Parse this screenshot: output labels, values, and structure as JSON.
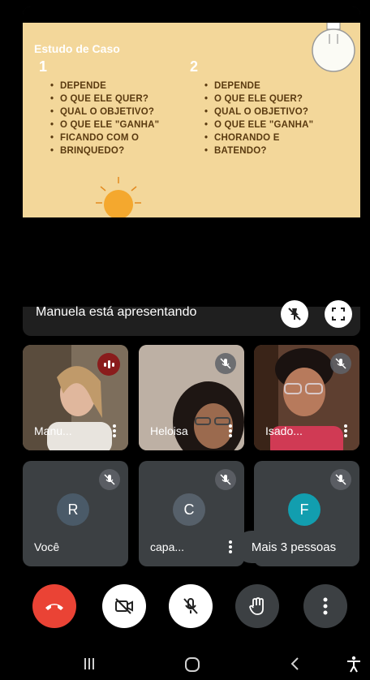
{
  "slide": {
    "title": "Estudo de Caso",
    "col1": {
      "number": "1",
      "bullets": [
        "DEPENDE",
        "O QUE ELE QUER?",
        "QUAL O OBJETIVO?",
        "O QUE ELE \"GANHA\"",
        "FICANDO COM O",
        "BRINQUEDO?"
      ]
    },
    "col2": {
      "number": "2",
      "bullets": [
        "DEPENDE",
        "O QUE ELE QUER?",
        "QUAL O OBJETIVO?",
        "O QUE ELE \"GANHA\"",
        "CHORANDO E",
        "BATENDO?"
      ]
    }
  },
  "presenting_label": "Manuela está apresentando",
  "participants": [
    {
      "name": "Manu...",
      "status": "speaking"
    },
    {
      "name": "Heloisa",
      "status": "muted"
    },
    {
      "name": "Isado...",
      "status": "muted"
    },
    {
      "name": "Você",
      "initial": "R",
      "status": "muted",
      "avatar_color": "#4a5a68"
    },
    {
      "name": "capa...",
      "initial": "C",
      "status": "muted",
      "avatar_color": "#56606a"
    },
    {
      "initial": "F",
      "status": "muted",
      "avatar_color": "#129eaf"
    }
  ],
  "more_people": "Mais 3 pessoas",
  "colors": {
    "slide_bg": "#f3d79a",
    "tile_bg": "#3c4043",
    "end_call": "#ea4335"
  }
}
